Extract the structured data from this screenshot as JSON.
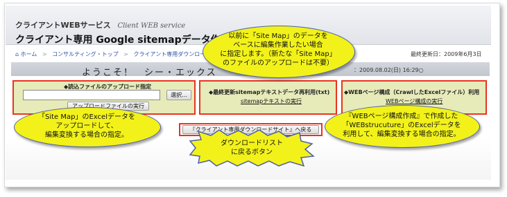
{
  "header": {
    "service_name": "クライアントWEBサービス",
    "service_name_en": "Client WEB service",
    "page_title": "クライアント専用 Google sitemapデータ作成",
    "last_updated": "最終更新日：2009年6月3日"
  },
  "breadcrumb": {
    "items": [
      "ホーム",
      "コンサルティング・トップ",
      "クライアント専用ダウンロード"
    ]
  },
  "welcome": {
    "text": "ようこそ！　シー・エックス",
    "last_login": "：2009.08.02(日) 16:29○"
  },
  "panels": {
    "upload": {
      "heading": "◆読込ファイルのアップロード指定",
      "select_button": "選択...",
      "run_button": "アップロードファイルの実行"
    },
    "sitemap_text": {
      "heading": "◆最終更新sitemapテキストデータ再利用(txt)",
      "link": "sitemapテキストの実行"
    },
    "web_structure": {
      "heading": "◆WEBページ構成（CrawlしたExcelファイル）利用",
      "link": "WEBページ構成の実行"
    }
  },
  "download_button": "『クライアント専用ダウンロードサイト』へ戻る",
  "callouts": {
    "top": [
      "以前に「Site Map」のデータを",
      "ベースに編集作業したい場合",
      "に指定します。（新たな「Site Map」",
      "のファイルのアップロードは不要）"
    ],
    "left": [
      "「Site Map」のExcelデータを",
      "アップロードして、",
      "編集変換する場合の指定。"
    ],
    "right": [
      "『WEBページ構成作成』で作成した",
      "「WEBstrucuture」のExcelデータを",
      "利用して、編集変換する場合の指定。"
    ],
    "bottom": [
      "ダウンロードリスト",
      "に戻るボタン"
    ]
  },
  "colors": {
    "panel_bg": "#e7ebb9",
    "panel_border": "#e8331f",
    "callout_fill": "#f2f21a",
    "callout_border": "#4c60a8",
    "link_blue": "#2e4fa3"
  }
}
